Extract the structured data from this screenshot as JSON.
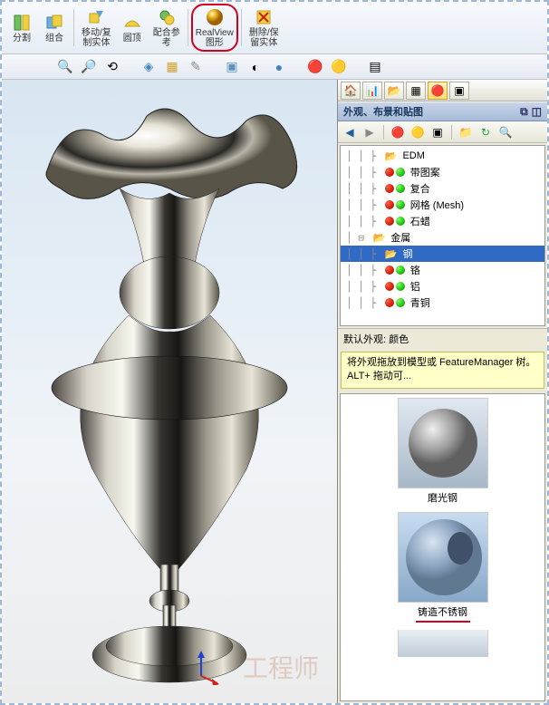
{
  "toolbar": {
    "split": "分割",
    "combine": "组合",
    "move_copy": "移动/复\n制实体",
    "dome": "圆顶",
    "mate_ref": "配合参\n考",
    "realview": "RealView\n图形",
    "delete_keep": "删除/保\n留实体"
  },
  "panel": {
    "title": "外观、布景和贴图",
    "default_appearance": "默认外观: 颜色",
    "hint": "将外观拖放到模型或 FeatureManager 树。ALT+ 拖动可..."
  },
  "tree": {
    "items": [
      {
        "indent": 2,
        "icon": "folder",
        "label": "EDM"
      },
      {
        "indent": 2,
        "icon": "ball",
        "label": "带图案"
      },
      {
        "indent": 2,
        "icon": "ball",
        "label": "复合"
      },
      {
        "indent": 2,
        "icon": "ball",
        "label": "网格 (Mesh)"
      },
      {
        "indent": 2,
        "icon": "ball",
        "label": "石蜡"
      },
      {
        "indent": 1,
        "icon": "folder",
        "label": "金属",
        "expanded": true
      },
      {
        "indent": 2,
        "icon": "folder",
        "label": "钢",
        "selected": true
      },
      {
        "indent": 2,
        "icon": "ball",
        "label": "铬"
      },
      {
        "indent": 2,
        "icon": "ball",
        "label": "铝"
      },
      {
        "indent": 2,
        "icon": "ball",
        "label": "青铜"
      }
    ]
  },
  "materials": {
    "polished_steel": "磨光钢",
    "cast_stainless": "铸造不锈钢"
  },
  "watermark": "工程师"
}
